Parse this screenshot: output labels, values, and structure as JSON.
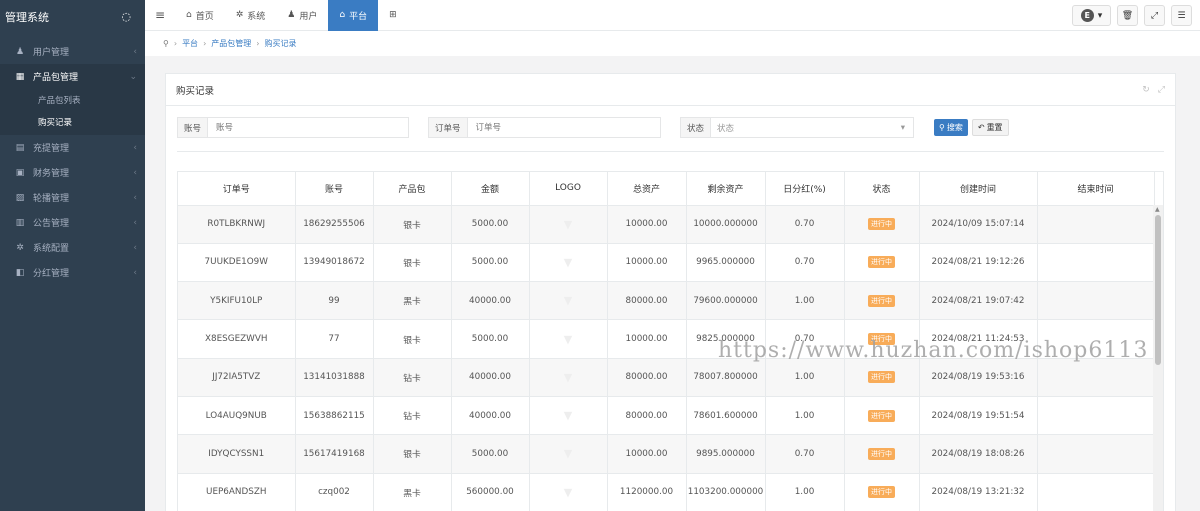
{
  "sidebar": {
    "brand": "管理系统",
    "menu": [
      {
        "icon": "user-icon",
        "glyph": "♟",
        "label": "用户管理",
        "arrow": "‹"
      },
      {
        "icon": "grid-icon",
        "glyph": "▦",
        "label": "产品包管理",
        "arrow": "⌄",
        "active": true,
        "children": [
          {
            "label": "产品包列表"
          },
          {
            "label": "购买记录",
            "active": true
          }
        ]
      },
      {
        "icon": "wallet-icon",
        "glyph": "▤",
        "label": "充提管理",
        "arrow": "‹"
      },
      {
        "icon": "money-icon",
        "glyph": "▣",
        "label": "财务管理",
        "arrow": "‹"
      },
      {
        "icon": "image-icon",
        "glyph": "▨",
        "label": "轮播管理",
        "arrow": "‹"
      },
      {
        "icon": "notice-icon",
        "glyph": "▥",
        "label": "公告管理",
        "arrow": "‹"
      },
      {
        "icon": "gear-icon",
        "glyph": "✲",
        "label": "系统配置",
        "arrow": "‹"
      },
      {
        "icon": "dividend-icon",
        "glyph": "◧",
        "label": "分红管理",
        "arrow": "‹"
      }
    ]
  },
  "topbar": {
    "tabs": [
      {
        "icon": "home-icon",
        "glyph": "⌂",
        "label": "首页"
      },
      {
        "icon": "gear-icon",
        "glyph": "✲",
        "label": "系统"
      },
      {
        "icon": "user-icon",
        "glyph": "♟",
        "label": "用户"
      },
      {
        "icon": "bank-icon",
        "glyph": "⌂",
        "label": "平台",
        "active": true
      }
    ],
    "right": {
      "lang": "E"
    }
  },
  "breadcrumb": [
    "平台",
    "产品包管理",
    "购买记录"
  ],
  "card": {
    "title": "购买记录",
    "filters": {
      "account_label": "账号",
      "account_placeholder": "账号",
      "order_label": "订单号",
      "order_placeholder": "订单号",
      "status_label": "状态",
      "status_value": "状态",
      "search_label": "搜索",
      "reset_label": "重置"
    },
    "columns": [
      "订单号",
      "账号",
      "产品包",
      "金额",
      "LOGO",
      "总资产",
      "剩余资产",
      "日分红(%)",
      "状态",
      "创建时间",
      "结束时间"
    ],
    "rows": [
      {
        "order": "R0TLBKRNWJ",
        "account": "18629255506",
        "pkg": "银卡",
        "amount": "5000.00",
        "total": "10000.00",
        "remain": "10000.000000",
        "rate": "0.70",
        "status": "进行中",
        "created": "2024/10/09 15:07:14",
        "ended": ""
      },
      {
        "order": "7UUKDE1O9W",
        "account": "13949018672",
        "pkg": "银卡",
        "amount": "5000.00",
        "total": "10000.00",
        "remain": "9965.000000",
        "rate": "0.70",
        "status": "进行中",
        "created": "2024/08/21 19:12:26",
        "ended": ""
      },
      {
        "order": "Y5KIFU10LP",
        "account": "99",
        "pkg": "黑卡",
        "amount": "40000.00",
        "total": "80000.00",
        "remain": "79600.000000",
        "rate": "1.00",
        "status": "进行中",
        "created": "2024/08/21 19:07:42",
        "ended": ""
      },
      {
        "order": "X8ESGEZWVH",
        "account": "77",
        "pkg": "银卡",
        "amount": "5000.00",
        "total": "10000.00",
        "remain": "9825.000000",
        "rate": "0.70",
        "status": "进行中",
        "created": "2024/08/21 11:24:53",
        "ended": ""
      },
      {
        "order": "JJ72IA5TVZ",
        "account": "13141031888",
        "pkg": "钻卡",
        "amount": "40000.00",
        "total": "80000.00",
        "remain": "78007.800000",
        "rate": "1.00",
        "status": "进行中",
        "created": "2024/08/19 19:53:16",
        "ended": ""
      },
      {
        "order": "LO4AUQ9NUB",
        "account": "15638862115",
        "pkg": "钻卡",
        "amount": "40000.00",
        "total": "80000.00",
        "remain": "78601.600000",
        "rate": "1.00",
        "status": "进行中",
        "created": "2024/08/19 19:51:54",
        "ended": ""
      },
      {
        "order": "IDYQCYSSN1",
        "account": "15617419168",
        "pkg": "银卡",
        "amount": "5000.00",
        "total": "10000.00",
        "remain": "9895.000000",
        "rate": "0.70",
        "status": "进行中",
        "created": "2024/08/19 18:08:26",
        "ended": ""
      },
      {
        "order": "UEP6ANDSZH",
        "account": "czq002",
        "pkg": "黑卡",
        "amount": "560000.00",
        "total": "1120000.00",
        "remain": "1103200.000000",
        "rate": "1.00",
        "status": "进行中",
        "created": "2024/08/19 13:21:32",
        "ended": ""
      }
    ]
  },
  "watermark": "https://www.huzhan.com/ishop6113"
}
